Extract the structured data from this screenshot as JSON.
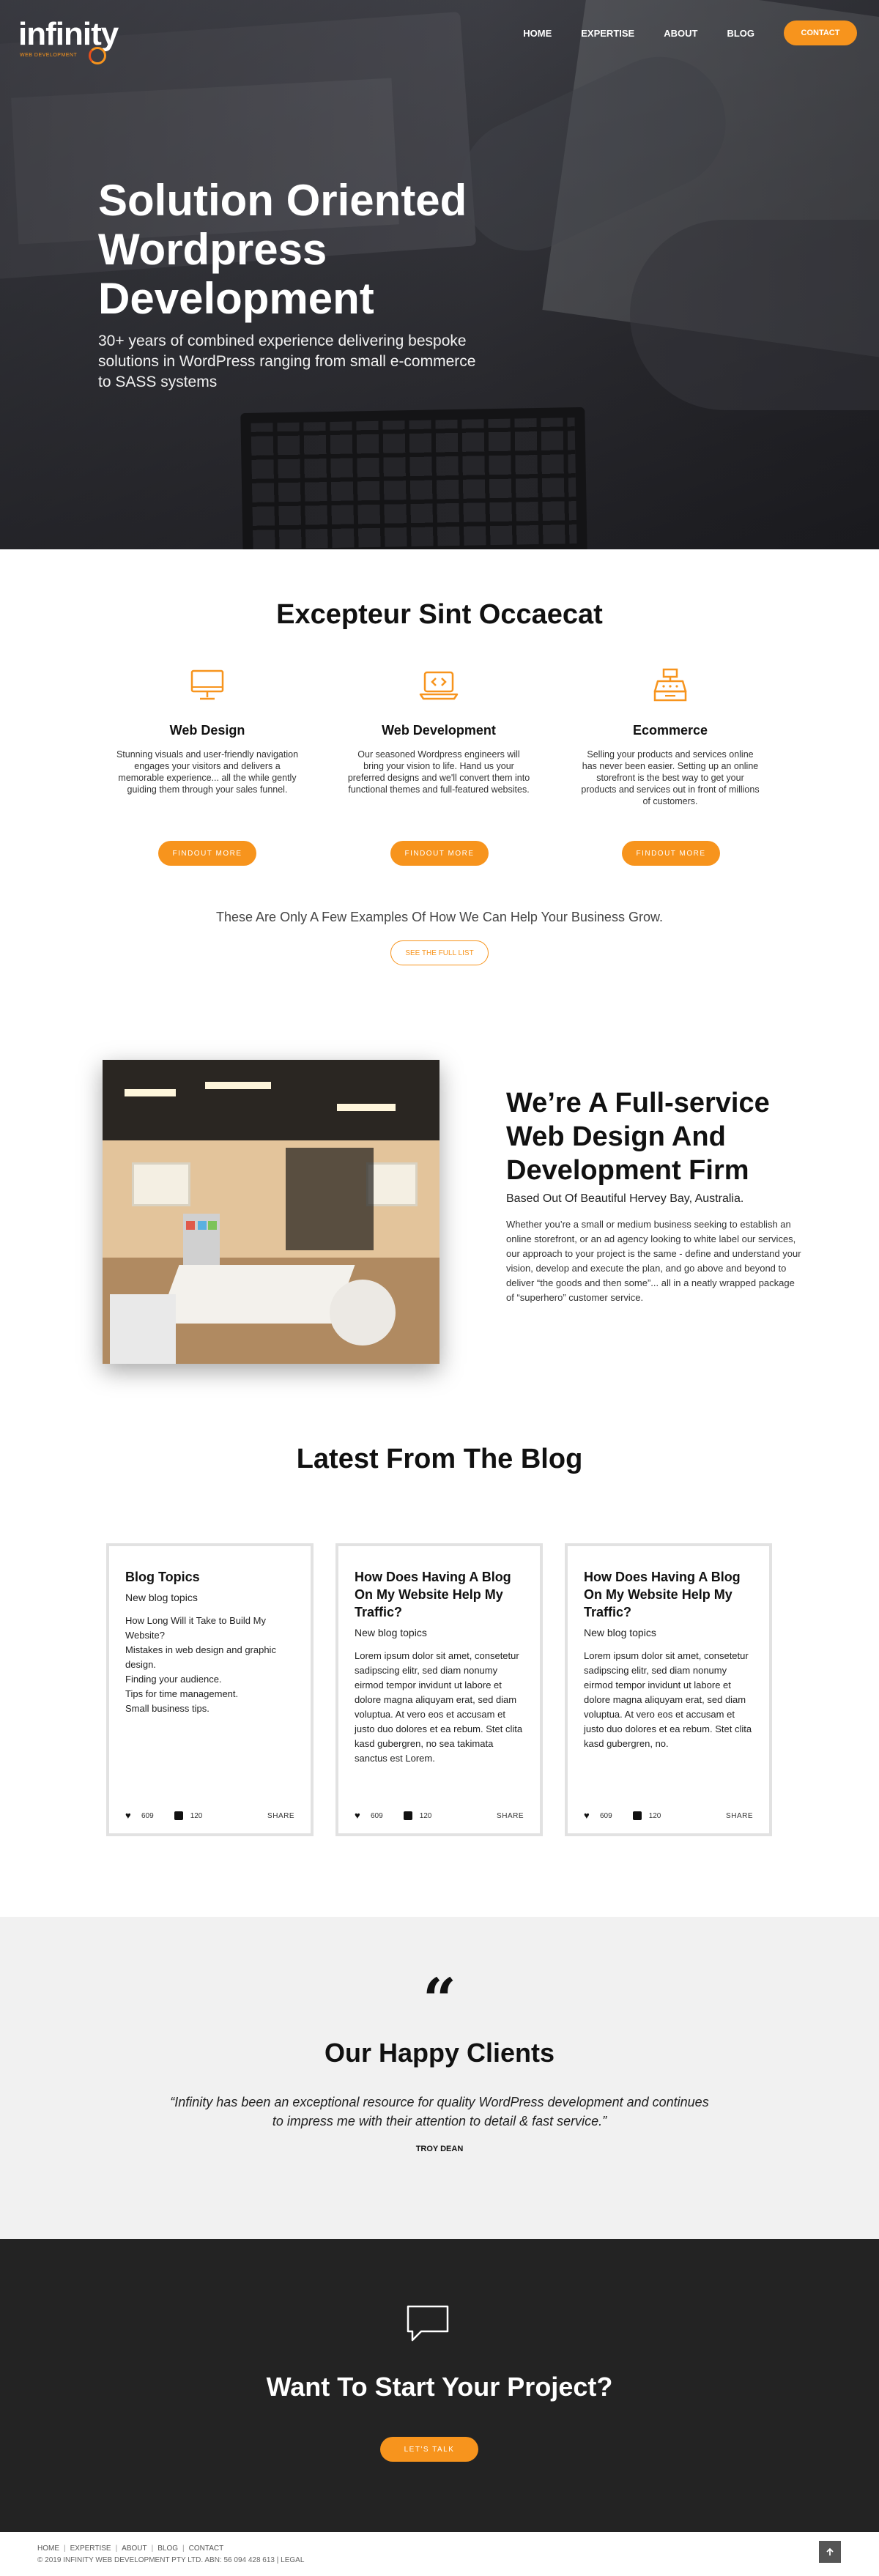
{
  "brand": {
    "name": "infinity",
    "tagline": "WEB DEVELOPMENT"
  },
  "colors": {
    "accent": "#f7941d",
    "dark": "#232323",
    "light_bg": "#f1f1f1"
  },
  "nav": {
    "items": [
      "HOME",
      "EXPERTISE",
      "ABOUT",
      "BLOG"
    ],
    "contact_label": "CONTACT"
  },
  "hero": {
    "title": "Solution Oriented Wordpress Development",
    "subtitle": "30+ years of combined experience delivering bespoke solutions in WordPress ranging from small e-commerce to SASS systems"
  },
  "services": {
    "title": "Excepteur Sint Occaecat",
    "items": [
      {
        "icon": "monitor-icon",
        "title": "Web Design",
        "text": "Stunning visuals and user-friendly navigation engages your visitors and delivers a memorable experience... all the while gently guiding them through your sales funnel.",
        "button": "FINDOUT MORE"
      },
      {
        "icon": "code-laptop-icon",
        "title": "Web Development",
        "text": "Our seasoned Wordpress engineers will bring your vision to life. Hand us your preferred designs and we'll convert them into functional themes and full-featured websites.",
        "button": "FINDOUT MORE"
      },
      {
        "icon": "cash-register-icon",
        "title": "Ecommerce",
        "text": "Selling your products and services online has never been easier. Setting up an online storefront is the best way to get your products and services out in front of millions of customers.",
        "button": "FINDOUT MORE"
      }
    ],
    "examples_text": "These Are Only A Few Examples Of How We Can Help Your Business Grow.",
    "see_list_label": "SEE THE FULL LIST"
  },
  "about": {
    "title": "We’re A Full-service Web Design And Development Firm",
    "location": "Based Out Of Beautiful Hervey Bay, Australia.",
    "text": "Whether you’re a small or medium business seeking to establish an online storefront, or an ad agency looking to white label our services, our approach to your project is the same - define and understand your vision, develop and execute the plan, and go above and beyond to deliver “the goods and then some”... all in a neatly wrapped package of “superhero” customer service."
  },
  "blog": {
    "title": "Latest From The Blog",
    "posts": [
      {
        "title": "Blog Topics",
        "subtitle": "New blog topics",
        "excerpt": "How Long Will it Take to Build My Website?\nMistakes in web design and graphic design.\nFinding your audience.\nTips for time management.\nSmall business tips.",
        "likes": "609",
        "comments": "120",
        "share": "SHARE"
      },
      {
        "title": "How Does Having A Blog On My Website Help My Traffic?",
        "subtitle": "New blog topics",
        "excerpt": "Lorem ipsum dolor sit amet, consetetur sadipscing elitr, sed diam nonumy eirmod tempor invidunt ut labore et dolore magna aliquyam erat, sed diam voluptua. At vero eos et accusam et justo duo dolores et ea rebum. Stet clita kasd gubergren, no sea takimata sanctus est Lorem.",
        "likes": "609",
        "comments": "120",
        "share": "SHARE"
      },
      {
        "title": "How Does Having A Blog On My Website Help My Traffic?",
        "subtitle": "New blog topics",
        "excerpt": "Lorem ipsum dolor sit amet, consetetur sadipscing elitr, sed diam nonumy eirmod tempor invidunt ut labore et dolore magna aliquyam erat, sed diam voluptua. At vero eos et accusam et justo duo dolores et ea rebum. Stet clita kasd gubergren, no.",
        "likes": "609",
        "comments": "120",
        "share": "SHARE"
      }
    ]
  },
  "testimonial": {
    "mark": "“",
    "title": "Our Happy Clients",
    "quote": "“Infinity has been an exceptional resource for quality WordPress development and continues to impress me with their attention to detail & fast service.”",
    "author": "TROY DEAN"
  },
  "cta": {
    "title": "Want To Start Your Project?",
    "button": "LET'S TALK"
  },
  "footer": {
    "nav": [
      "HOME",
      "EXPERTISE",
      "ABOUT",
      "BLOG",
      "CONTACT"
    ],
    "separator": "|",
    "copyright": "© 2019 INFINITY WEB DEVELOPMENT PTY LTD. ABN: 56 094 428 613 | LEGAL"
  }
}
